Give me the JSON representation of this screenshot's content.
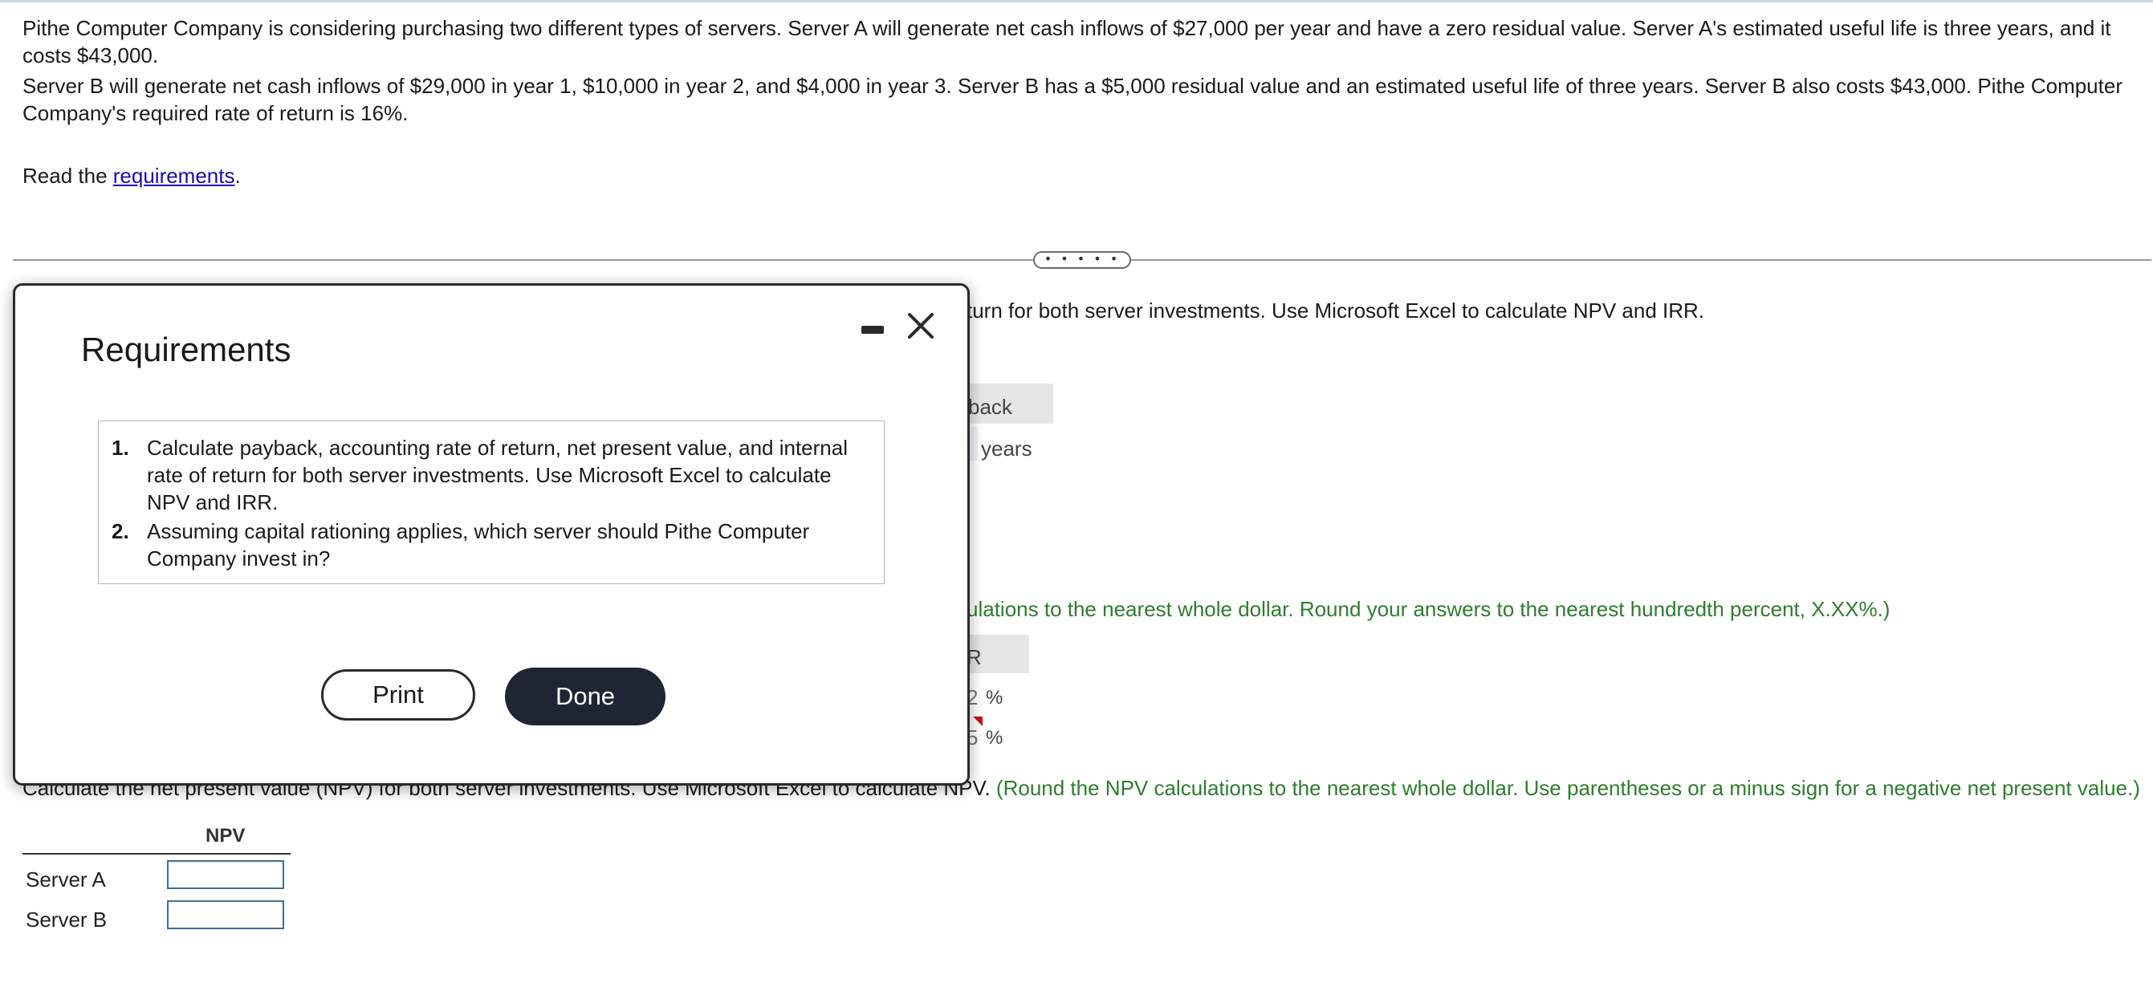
{
  "problem": {
    "para1": "Pithe Computer Company is considering purchasing two different types of servers. Server A will generate net cash inflows of $27,000 per year and have a zero residual value. Server A's estimated useful life is three years, and it costs $43,000.",
    "para2": "Server B will generate net cash inflows of $29,000 in year 1, $10,000 in year 2, and $4,000 in year 3. Server B has a $5,000 residual value and an estimated useful life of three years. Server B also costs $43,000. Pithe Computer Company's required rate of return is 16%.",
    "read_prefix": "Read the ",
    "read_link": "requirements",
    "read_suffix": "."
  },
  "divider": {
    "handle_label": "• • • • •"
  },
  "background": {
    "instruction_partial": "turn for both server investments. Use Microsoft Excel to calculate NPV and IRR.",
    "payback_header_partial": "back",
    "years_value_partial": "",
    "years_unit": "years",
    "irr_instruction_partial": "ulations to the nearest whole dollar. Round your answers to the nearest hundredth percent, X.XX%.)",
    "irr_header_partial": "R",
    "irr_a_partial": "2",
    "irr_b_partial": "5",
    "percent_sign": "%"
  },
  "npv_section": {
    "instruction": "Calculate the net present value (NPV) for both server investments. Use Microsoft Excel to calculate NPV.",
    "instruction_green": "(Round the NPV calculations to the nearest whole dollar. Use parentheses or a minus sign for a negative net present value.)",
    "column_header": "NPV",
    "rows": [
      {
        "label": "Server A",
        "value": ""
      },
      {
        "label": "Server B",
        "value": ""
      }
    ]
  },
  "modal": {
    "title": "Requirements",
    "minimize_icon": "minimize-icon",
    "close_icon": "close-icon",
    "requirements": [
      {
        "num": "1.",
        "text": "Calculate payback, accounting rate of return, net present value, and internal rate of return for both server investments. Use Microsoft Excel to calculate NPV and IRR."
      },
      {
        "num": "2.",
        "text": "Assuming capital rationing applies, which server should Pithe Computer Company invest in?"
      }
    ],
    "print_label": "Print",
    "done_label": "Done"
  },
  "colors": {
    "green_text": "#2d7d2d",
    "done_button": "#1f2533",
    "link": "#1a0dab",
    "input_border": "#3d6f8c"
  }
}
